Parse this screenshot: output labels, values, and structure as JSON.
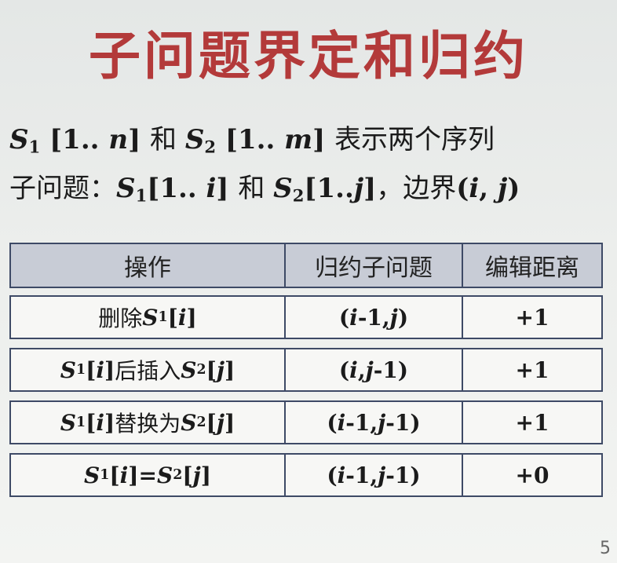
{
  "title": "子问题界定和归约",
  "line1": {
    "s1": "S",
    "s1_sub": "1",
    "s1_range_a": " [1.. ",
    "s1_var": "n",
    "s1_range_b": "] ",
    "and": "和 ",
    "s2": "S",
    "s2_sub": "2",
    "s2_range_a": " [1.. ",
    "s2_var": "m",
    "s2_range_b": "] ",
    "desc": "表示两个序列"
  },
  "line2": {
    "label": "子问题：",
    "s1": "S",
    "s1_sub": "1",
    "s1_range_a": "[1.. ",
    "s1_var": "i",
    "s1_range_b": "] ",
    "and": "和 ",
    "s2": "S",
    "s2_sub": "2",
    "s2_range_a": "[1..",
    "s2_var": "j",
    "s2_range_b": "]",
    "boundary": "，边界",
    "b_open": "(",
    "b_i": "i",
    "b_comma": ", ",
    "b_j": "j",
    "b_close": ")"
  },
  "table": {
    "headers": [
      "操作",
      "归约子问题",
      "编辑距离"
    ],
    "rows": [
      {
        "op": "删除S1[i]",
        "sub": "(i-1, j)",
        "cost": "+1"
      },
      {
        "op": "S1[i]后插入S2[j]",
        "sub": "(i, j-1)",
        "cost": "+1"
      },
      {
        "op": "S1[i]替换为S2[j]",
        "sub": "(i-1, j-1)",
        "cost": "+1"
      },
      {
        "op": "S1[i]=S2[j]",
        "sub": "(i-1, j-1)",
        "cost": "+0"
      }
    ]
  },
  "page_number": "5"
}
